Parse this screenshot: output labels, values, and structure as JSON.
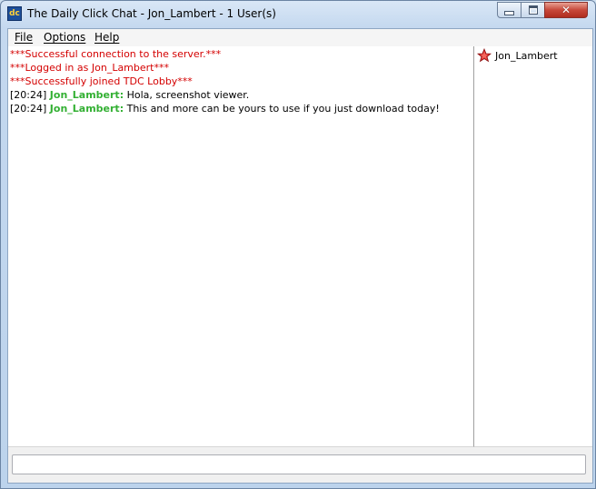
{
  "window": {
    "title": "The Daily Click Chat - Jon_Lambert - 1 User(s)",
    "icon_name": "daily-click-app-icon",
    "controls": {
      "minimize": "minimize-icon",
      "maximize": "maximize-icon",
      "close": "close-icon"
    }
  },
  "menu": {
    "items": [
      {
        "label": "File"
      },
      {
        "label": "Options"
      },
      {
        "label": "Help"
      }
    ]
  },
  "chat": {
    "system_messages": [
      "***Successful connection to the server.***",
      "***Logged in as Jon_Lambert***",
      "***Successfully joined TDC Lobby***"
    ],
    "messages": [
      {
        "time": "[20:24]",
        "nick": "Jon_Lambert:",
        "text": "Hola, screenshot viewer."
      },
      {
        "time": "[20:24]",
        "nick": "Jon_Lambert:",
        "text": "This and more can be yours to use if you just download today!"
      }
    ]
  },
  "users": {
    "list": [
      {
        "name": "Jon_Lambert",
        "icon": "star-icon"
      }
    ]
  },
  "input": {
    "value": ""
  },
  "colors": {
    "system_text": "#d40000",
    "nick_text": "#33b033",
    "close_button": "#c7483a"
  }
}
